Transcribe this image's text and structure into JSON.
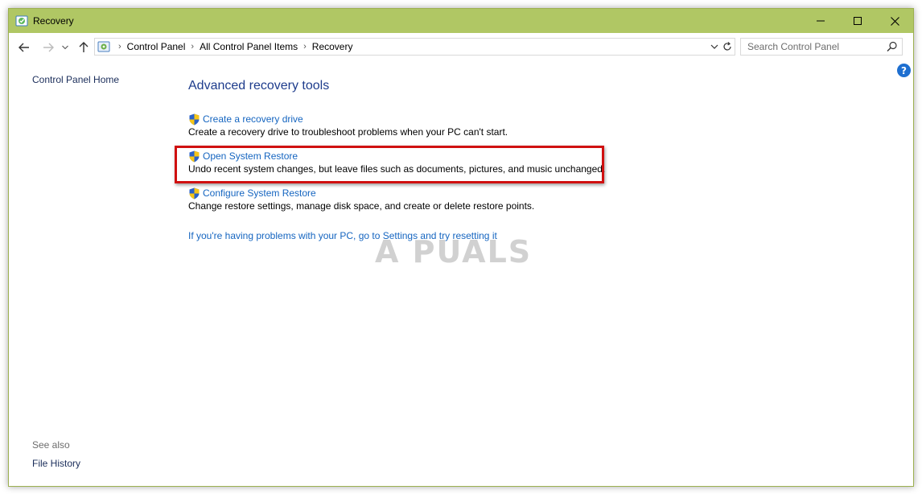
{
  "window": {
    "title": "Recovery",
    "titlebar_color": "#b0c764",
    "controls": {
      "minimize": "minimize-icon",
      "maximize": "maximize-icon",
      "close": "close-icon"
    }
  },
  "nav": {
    "back": "back-arrow-icon",
    "forward": "forward-arrow-icon",
    "recent": "chevron-down-icon",
    "up": "up-arrow-icon"
  },
  "address": {
    "breadcrumbs": [
      "Control Panel",
      "All Control Panel Items",
      "Recovery"
    ]
  },
  "search": {
    "placeholder": "Search Control Panel"
  },
  "left_pane": {
    "home_link": "Control Panel Home",
    "see_also_label": "See also",
    "file_history_link": "File History"
  },
  "main": {
    "heading": "Advanced recovery tools",
    "tasks": [
      {
        "link": "Create a recovery drive",
        "description": "Create a recovery drive to troubleshoot problems when your PC can't start."
      },
      {
        "link": "Open System Restore",
        "description": "Undo recent system changes, but leave files such as documents, pictures, and music unchanged."
      },
      {
        "link": "Configure System Restore",
        "description": "Change restore settings, manage disk space, and create or delete restore points."
      }
    ],
    "reset_link": "If you're having problems with your PC, go to Settings and try resetting it"
  },
  "watermark": "A PUALS",
  "colors": {
    "link": "#1565c0",
    "heading": "#1e3c8c",
    "highlight": "#d01010"
  }
}
